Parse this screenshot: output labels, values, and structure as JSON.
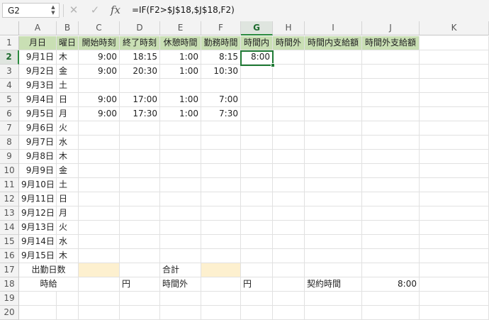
{
  "formula_bar": {
    "name_box": "G2",
    "cancel_icon": "x-icon",
    "confirm_icon": "check-icon",
    "fx_label": "fx",
    "formula": "=IF(F2>$J$18,$J$18,F2)"
  },
  "columns": [
    "A",
    "B",
    "C",
    "D",
    "E",
    "F",
    "G",
    "H",
    "I",
    "J",
    "K"
  ],
  "rows": [
    "1",
    "2",
    "3",
    "4",
    "5",
    "6",
    "7",
    "8",
    "9",
    "10",
    "11",
    "12",
    "13",
    "14",
    "15",
    "16",
    "17",
    "18",
    "19",
    "20"
  ],
  "selected": {
    "column": "G",
    "row": "2"
  },
  "header_row": [
    "月日",
    "曜日",
    "開始時刻",
    "終了時刻",
    "休憩時間",
    "勤務時間",
    "時間内",
    "時間外",
    "時間内支給額",
    "時間外支給額"
  ],
  "days": [
    {
      "date": "9月1日",
      "dow": "木",
      "start": "9:00",
      "end": "18:15",
      "break": "1:00",
      "work": "8:15",
      "within": "8:00"
    },
    {
      "date": "9月2日",
      "dow": "金",
      "start": "9:00",
      "end": "20:30",
      "break": "1:00",
      "work": "10:30",
      "within": ""
    },
    {
      "date": "9月3日",
      "dow": "土",
      "start": "",
      "end": "",
      "break": "",
      "work": "",
      "within": ""
    },
    {
      "date": "9月4日",
      "dow": "日",
      "start": "9:00",
      "end": "17:00",
      "break": "1:00",
      "work": "7:00",
      "within": ""
    },
    {
      "date": "9月5日",
      "dow": "月",
      "start": "9:00",
      "end": "17:30",
      "break": "1:00",
      "work": "7:30",
      "within": ""
    },
    {
      "date": "9月6日",
      "dow": "火",
      "start": "",
      "end": "",
      "break": "",
      "work": "",
      "within": ""
    },
    {
      "date": "9月7日",
      "dow": "水",
      "start": "",
      "end": "",
      "break": "",
      "work": "",
      "within": ""
    },
    {
      "date": "9月8日",
      "dow": "木",
      "start": "",
      "end": "",
      "break": "",
      "work": "",
      "within": ""
    },
    {
      "date": "9月9日",
      "dow": "金",
      "start": "",
      "end": "",
      "break": "",
      "work": "",
      "within": ""
    },
    {
      "date": "9月10日",
      "dow": "土",
      "start": "",
      "end": "",
      "break": "",
      "work": "",
      "within": ""
    },
    {
      "date": "9月11日",
      "dow": "日",
      "start": "",
      "end": "",
      "break": "",
      "work": "",
      "within": ""
    },
    {
      "date": "9月12日",
      "dow": "月",
      "start": "",
      "end": "",
      "break": "",
      "work": "",
      "within": ""
    },
    {
      "date": "9月13日",
      "dow": "火",
      "start": "",
      "end": "",
      "break": "",
      "work": "",
      "within": ""
    },
    {
      "date": "9月14日",
      "dow": "水",
      "start": "",
      "end": "",
      "break": "",
      "work": "",
      "within": ""
    },
    {
      "date": "9月15日",
      "dow": "木",
      "start": "",
      "end": "",
      "break": "",
      "work": "",
      "within": ""
    }
  ],
  "summary": {
    "workdays_label": "出勤日数",
    "total_label": "合計",
    "hourly_label": "時給",
    "yen_label_1": "円",
    "overtime_label": "時間外",
    "yen_label_2": "円",
    "contract_label": "契約時間",
    "contract_value": "8:00"
  },
  "colors": {
    "header_fill": "#c9dfb4",
    "input_fill": "#fdf0cf",
    "selection_green": "#1f7a35"
  }
}
